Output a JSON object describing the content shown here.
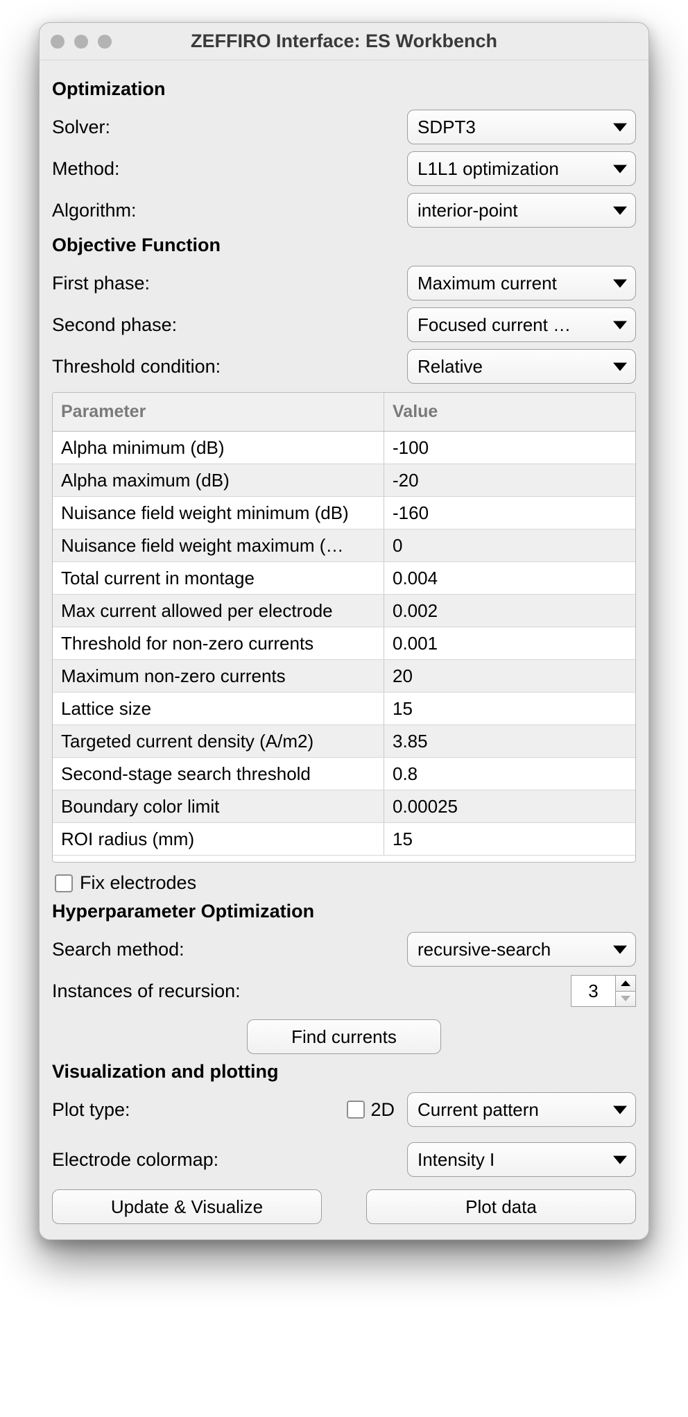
{
  "window": {
    "title": "ZEFFIRO Interface: ES Workbench"
  },
  "optimization": {
    "heading": "Optimization",
    "solver_label": "Solver:",
    "solver_value": "SDPT3",
    "method_label": "Method:",
    "method_value": "L1L1 optimization",
    "algorithm_label": "Algorithm:",
    "algorithm_value": "interior-point"
  },
  "objective": {
    "heading": "Objective Function",
    "first_phase_label": "First phase:",
    "first_phase_value": "Maximum current",
    "second_phase_label": "Second phase:",
    "second_phase_value": "Focused current …",
    "threshold_label": "Threshold condition:",
    "threshold_value": "Relative"
  },
  "table": {
    "header_param": "Parameter",
    "header_value": "Value",
    "rows": [
      {
        "param": "Alpha minimum (dB)",
        "value": "-100"
      },
      {
        "param": "Alpha maximum (dB)",
        "value": "-20"
      },
      {
        "param": "Nuisance field weight minimum (dB)",
        "value": "-160"
      },
      {
        "param": "Nuisance field weight maximum (…",
        "value": "0"
      },
      {
        "param": "Total current in montage",
        "value": "0.004"
      },
      {
        "param": "Max current allowed per electrode",
        "value": "0.002"
      },
      {
        "param": "Threshold for non-zero currents",
        "value": "0.001"
      },
      {
        "param": "Maximum non-zero currents",
        "value": "20"
      },
      {
        "param": "Lattice size",
        "value": "15"
      },
      {
        "param": "Targeted current density (A/m2)",
        "value": "3.85"
      },
      {
        "param": "Second-stage search threshold",
        "value": "0.8"
      },
      {
        "param": "Boundary color limit",
        "value": "0.00025"
      },
      {
        "param": "ROI radius (mm)",
        "value": "15"
      }
    ]
  },
  "fix_electrodes_label": "Fix electrodes",
  "hyper": {
    "heading": "Hyperparameter Optimization",
    "search_label": "Search method:",
    "search_value": "recursive-search",
    "instances_label": "Instances of recursion:",
    "instances_value": "3",
    "find_currents_label": "Find currents"
  },
  "viz": {
    "heading": "Visualization and plotting",
    "plot_type_label": "Plot type:",
    "two_d_label": "2D",
    "plot_type_value": "Current pattern",
    "colormap_label": "Electrode colormap:",
    "colormap_value": "Intensity I",
    "update_label": "Update & Visualize",
    "plot_data_label": "Plot data"
  }
}
